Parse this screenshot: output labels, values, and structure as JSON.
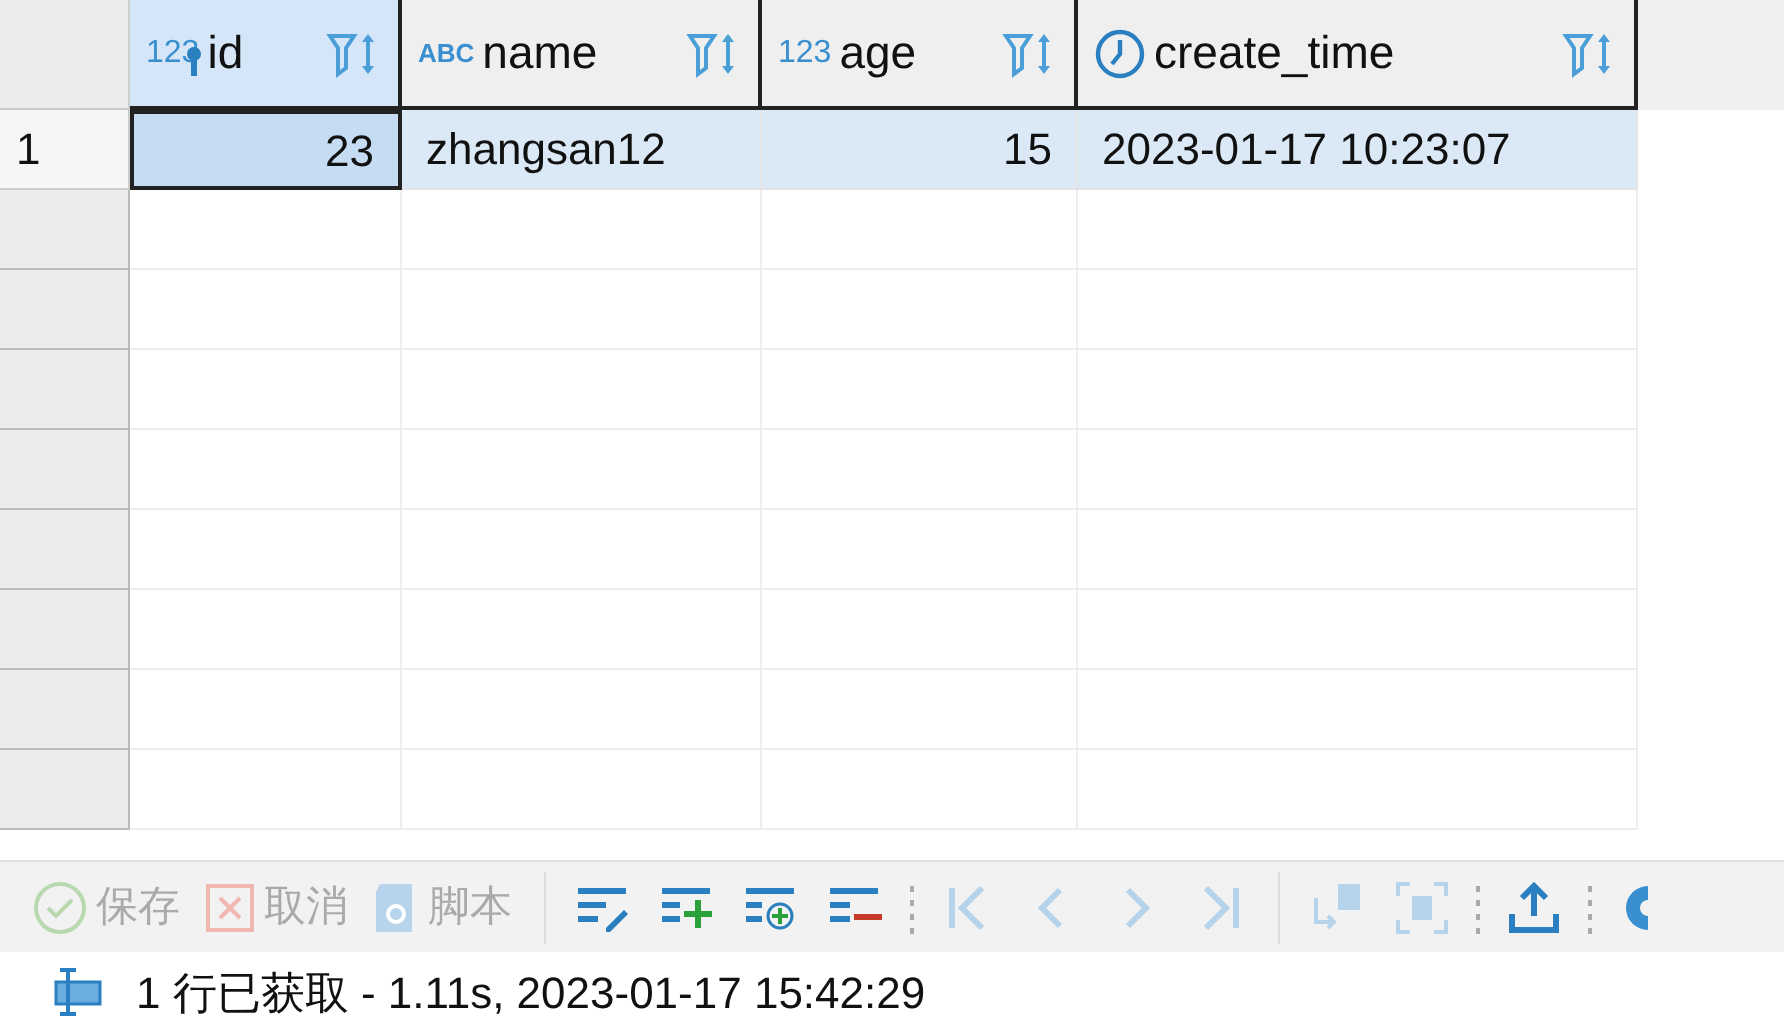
{
  "table": {
    "columns": [
      {
        "label": "id",
        "type_badge": "123",
        "kind": "key",
        "selected": true
      },
      {
        "label": "name",
        "type_badge": "ABC",
        "kind": "text",
        "selected": false
      },
      {
        "label": "age",
        "type_badge": "123",
        "kind": "number",
        "selected": false
      },
      {
        "label": "create_time",
        "kind": "datetime",
        "selected": false
      }
    ],
    "rows": [
      {
        "number": "1",
        "selected": true,
        "cells": [
          {
            "text": "23",
            "focused": true
          },
          {
            "text": "zhangsan12",
            "focused": false
          },
          {
            "text": "15",
            "focused": false
          },
          {
            "text": "2023-01-17 10:23:07",
            "focused": false
          }
        ]
      }
    ]
  },
  "toolbar": {
    "actions": [
      {
        "kind": "save",
        "label": "保存",
        "disabled": true
      },
      {
        "kind": "cancel",
        "label": "取消",
        "disabled": true
      },
      {
        "kind": "script",
        "label": "脚本",
        "disabled": true
      }
    ],
    "tools": [
      {
        "kind": "edit-row",
        "disabled": false
      },
      {
        "kind": "add-row",
        "disabled": false
      },
      {
        "kind": "copy-row",
        "disabled": false
      },
      {
        "kind": "delete-row",
        "disabled": false
      },
      {
        "kind": "sep"
      },
      {
        "kind": "first",
        "disabled": true
      },
      {
        "kind": "prev",
        "disabled": true
      },
      {
        "kind": "next",
        "disabled": true
      },
      {
        "kind": "last",
        "disabled": true
      },
      {
        "kind": "bar"
      },
      {
        "kind": "fetch",
        "disabled": true
      },
      {
        "kind": "fit",
        "disabled": true
      },
      {
        "kind": "sep"
      },
      {
        "kind": "export",
        "disabled": false
      },
      {
        "kind": "sep"
      },
      {
        "kind": "settings",
        "disabled": false
      }
    ]
  },
  "status_bar": {
    "text": "1 行已获取 - 1.11s, 2023-01-17 15:42:29"
  }
}
